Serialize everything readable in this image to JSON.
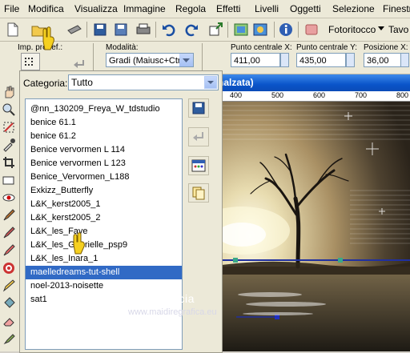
{
  "menu": [
    "File",
    "Modifica",
    "Visualizza",
    "Immagine",
    "Regola",
    "Effetti",
    "Livelli",
    "Oggetti",
    "Selezione",
    "Finestra"
  ],
  "options": {
    "preset_label": "Imp. predef.:",
    "mode_label": "Modalità:",
    "mode_value": "Gradi (Maiusc+Ctrl)",
    "center_x_label": "Punto centrale X:",
    "center_x_value": "411,00",
    "center_y_label": "Punto centrale Y:",
    "center_y_value": "435,00",
    "pos_x_label": "Posizione X:",
    "pos_x_value": "36,00"
  },
  "toolbar": {
    "photo_fix_label": "Fotoritocco",
    "tab_label": "Tavo"
  },
  "image_window": {
    "title_suffix": "nalzata)",
    "ruler_labels": [
      "400",
      "500",
      "600",
      "700",
      "800"
    ]
  },
  "dialog": {
    "category_label": "Categoria:",
    "category_value": "Tutto",
    "selected_index": 13,
    "items": [
      "@nn_130209_Freya_W_tdstudio",
      "benice 61.1",
      "benice 61.2",
      "Benice vervormen L 114",
      "Benice vervormen L 123",
      "Benice_Vervormen_L188",
      "Exkizz_Butterfly",
      "L&K_kerst2005_1",
      "L&K_kerst2005_2",
      "L&K_les_Faye",
      "L&K_les_Gabrielle_psp9",
      "L&K_les_Inara_1",
      "maelledreams-tut-shell",
      "maelledreams-tut-shell",
      "noel-2013-noisette",
      "sat1"
    ]
  },
  "watermark": {
    "name": "Pinuccia",
    "url": "www.maidiregrafica.eu"
  }
}
